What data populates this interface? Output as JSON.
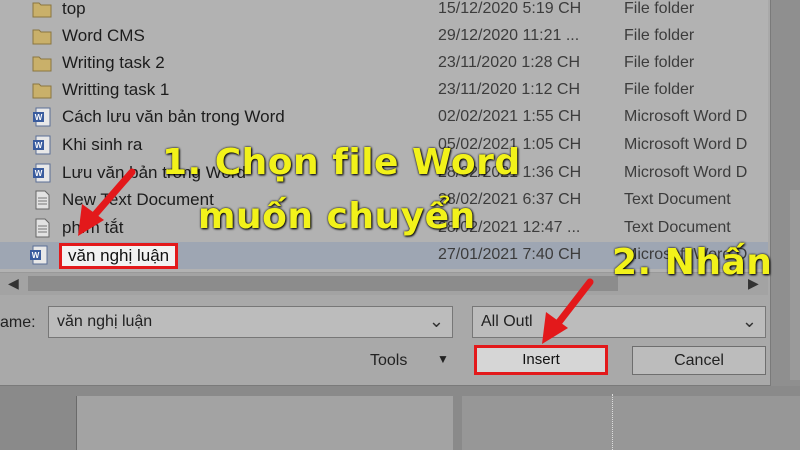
{
  "files": [
    {
      "name": "top",
      "date": "15/12/2020 5:19 CH",
      "type": "File folder",
      "icon": "folder-icon"
    },
    {
      "name": "Word CMS",
      "date": "29/12/2020 11:21 ...",
      "type": "File folder",
      "icon": "folder-icon"
    },
    {
      "name": "Writing task 2",
      "date": "23/11/2020 1:28 CH",
      "type": "File folder",
      "icon": "folder-icon"
    },
    {
      "name": "Writting task 1",
      "date": "23/11/2020 1:12 CH",
      "type": "File folder",
      "icon": "folder-icon"
    },
    {
      "name": "Cách lưu văn bản trong Word",
      "date": "02/02/2021 1:55 CH",
      "type": "Microsoft Word D",
      "icon": "word-doc-icon"
    },
    {
      "name": "Khi sinh ra",
      "date": "05/02/2021 1:05 CH",
      "type": "Microsoft Word D",
      "icon": "word-doc-icon"
    },
    {
      "name": "Lưu văn bản trong Word",
      "date": "28/02/2021 1:36 CH",
      "type": "Microsoft Word D",
      "icon": "word-doc-icon"
    },
    {
      "name": "New Text Document",
      "date": "28/02/2021 6:37 CH",
      "type": "Text Document",
      "icon": "text-doc-icon"
    },
    {
      "name": "phím tắt",
      "date": "28/02/2021 12:47 ...",
      "type": "Text Document",
      "icon": "text-doc-icon"
    },
    {
      "name": "văn nghị luận",
      "date": "27/01/2021 7:40 CH",
      "type": "Microsoft Word D",
      "icon": "word-doc-icon",
      "selected": true
    }
  ],
  "filename": {
    "label": "ame:",
    "value": "văn nghị luận"
  },
  "filetype": {
    "value": "All Outl"
  },
  "tools_label": "Tools",
  "insert_label": "Insert",
  "cancel_label": "Cancel",
  "annotations": {
    "step1_line1": "1. Chọn file Word",
    "step1_line2": "muốn chuyển",
    "step2": "2. Nhấn"
  },
  "colors": {
    "highlight_red": "#e3191b",
    "annotation_yellow": "#f2f21a"
  }
}
